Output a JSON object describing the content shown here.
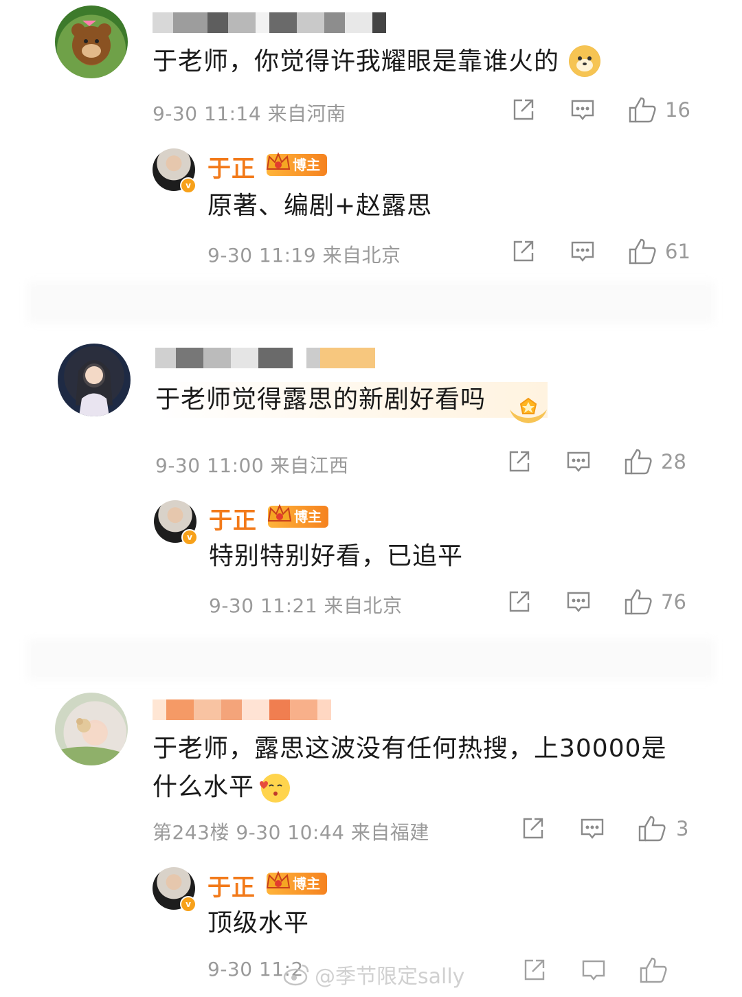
{
  "threads": [
    {
      "comment": {
        "text": "于老师，你觉得许我耀眼是靠谁火的",
        "meta": "9-30 11:14 来自河南",
        "likes": "16"
      },
      "reply": {
        "name": "于正",
        "badge": "博主",
        "text": "原著、编剧+赵露思",
        "meta": "9-30 11:19 来自北京",
        "likes": "61"
      }
    },
    {
      "comment": {
        "text": "于老师觉得露思的新剧好看吗",
        "meta": "9-30 11:00 来自江西",
        "likes": "28"
      },
      "reply": {
        "name": "于正",
        "badge": "博主",
        "text": "特别特别好看，已追平",
        "meta": "9-30 11:21 来自北京",
        "likes": "76"
      }
    },
    {
      "comment": {
        "text_line1": "于老师，露思这波没有任何热搜，上30000是",
        "text_line2": "什么水平",
        "meta": "第243楼 9-30 10:44 来自福建",
        "likes": "3"
      },
      "reply": {
        "name": "于正",
        "badge": "博主",
        "text": "顶级水平",
        "meta": "9-30 11:2",
        "likes": ""
      }
    }
  ],
  "watermark": "@季节限定sally",
  "icons": {
    "share": "share-icon",
    "comment": "comment-icon",
    "like": "thumbs-up-icon"
  },
  "colors": {
    "reply_name": "#f27a1a",
    "meta": "#9a9a9a"
  }
}
